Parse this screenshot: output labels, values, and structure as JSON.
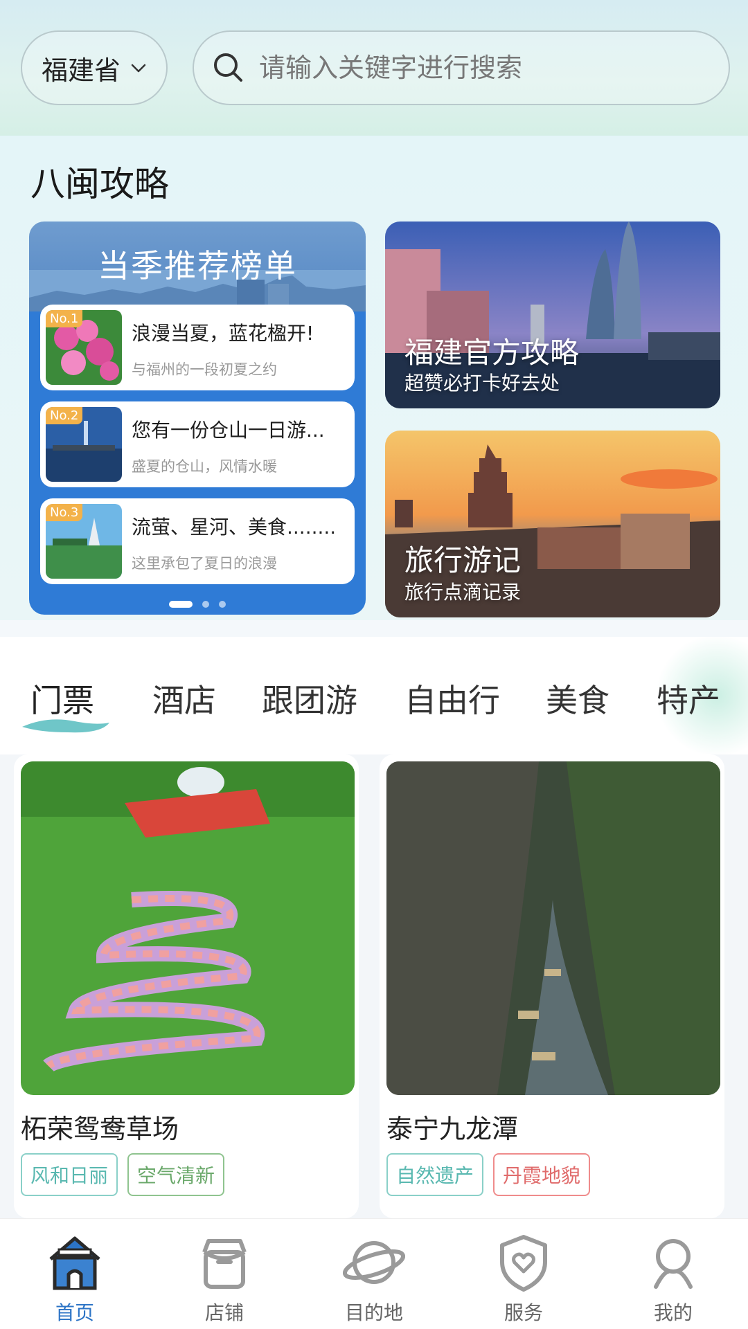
{
  "header": {
    "province": "福建省",
    "search_placeholder": "请输入关键字进行搜索"
  },
  "guides": {
    "title": "八闽攻略",
    "ranking": {
      "title": "当季推荐榜单",
      "items": [
        {
          "badge": "No.1",
          "title": "浪漫当夏，蓝花楹开!",
          "subtitle": "与福州的一段初夏之约"
        },
        {
          "badge": "No.2",
          "title": "您有一份仓山一日游...",
          "subtitle": "盛夏的仓山，风情水暖"
        },
        {
          "badge": "No.3",
          "title": "流萤、星河、美食........",
          "subtitle": "这里承包了夏日的浪漫"
        }
      ]
    },
    "promos": [
      {
        "title": "福建官方攻略",
        "subtitle": "超赞必打卡好去处"
      },
      {
        "title": "旅行游记",
        "subtitle": "旅行点滴记录"
      }
    ]
  },
  "tabs": [
    "门票",
    "酒店",
    "跟团游",
    "自由行",
    "美食",
    "特产"
  ],
  "products": [
    {
      "name": "柘荣鸳鸯草场",
      "tags": [
        "风和日丽",
        "空气清新"
      ]
    },
    {
      "name": "泰宁九龙潭",
      "tags": [
        "自然遗产",
        "丹霞地貌"
      ]
    }
  ],
  "bottom_nav": [
    {
      "label": "首页",
      "icon": "home-icon"
    },
    {
      "label": "店铺",
      "icon": "store-icon"
    },
    {
      "label": "目的地",
      "icon": "planet-icon"
    },
    {
      "label": "服务",
      "icon": "shield-heart-icon"
    },
    {
      "label": "我的",
      "icon": "user-icon"
    }
  ],
  "colors": {
    "accent": "#2c74c6",
    "ranking_bg": "#2f7bd6",
    "tag_teal": "#59b8b0",
    "tag_green": "#6aa86a",
    "tag_red": "#e06b6b"
  }
}
